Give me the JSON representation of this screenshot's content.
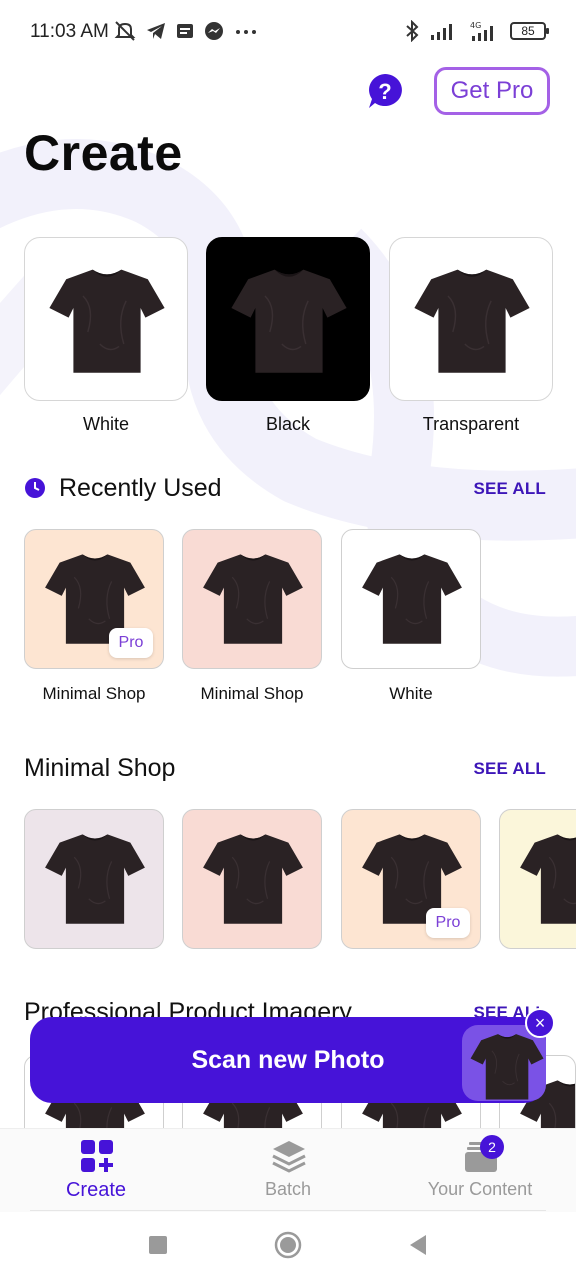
{
  "status_bar": {
    "time": "11:03 AM",
    "battery": "85",
    "network": "4G",
    "left_icons": [
      "mute-icon",
      "telegram-icon",
      "message-icon",
      "messenger-icon",
      "more-icon"
    ],
    "right_icons": [
      "bluetooth-icon",
      "signal-icon",
      "signal-4g-icon",
      "battery-icon"
    ]
  },
  "header": {
    "help_icon": "help-icon",
    "get_pro_label": "Get Pro",
    "title": "Create"
  },
  "backgrounds": [
    {
      "label": "White",
      "color": "#ffffff"
    },
    {
      "label": "Black",
      "color": "#000000"
    },
    {
      "label": "Transparent",
      "color": "#ffffff"
    }
  ],
  "recently_used": {
    "title": "Recently Used",
    "see_all": "SEE ALL",
    "items": [
      {
        "label": "Minimal Shop",
        "color": "#fde5d2",
        "badge": "Pro"
      },
      {
        "label": "Minimal Shop",
        "color": "#f9dbd4",
        "badge": ""
      },
      {
        "label": "White",
        "color": "#ffffff",
        "badge": ""
      }
    ]
  },
  "minimal_shop": {
    "title": "Minimal Shop",
    "see_all": "SEE ALL",
    "items": [
      {
        "color": "#ede4ea",
        "badge": ""
      },
      {
        "color": "#f9dbd4",
        "badge": ""
      },
      {
        "color": "#fde5d2",
        "badge": "Pro"
      },
      {
        "color": "#fbf6da",
        "badge": ""
      }
    ]
  },
  "professional": {
    "title": "Professional Product Imagery",
    "see_all": "SEE ALL"
  },
  "scan": {
    "label": "Scan new Photo",
    "close": "×"
  },
  "bottom_nav": {
    "items": [
      {
        "label": "Create",
        "icon": "create-grid-icon",
        "active": true
      },
      {
        "label": "Batch",
        "icon": "layers-icon",
        "active": false
      },
      {
        "label": "Your Content",
        "icon": "content-stack-icon",
        "active": false,
        "badge": "2"
      }
    ]
  },
  "colors": {
    "accent": "#4613d8",
    "pro": "#7b3fd6"
  }
}
